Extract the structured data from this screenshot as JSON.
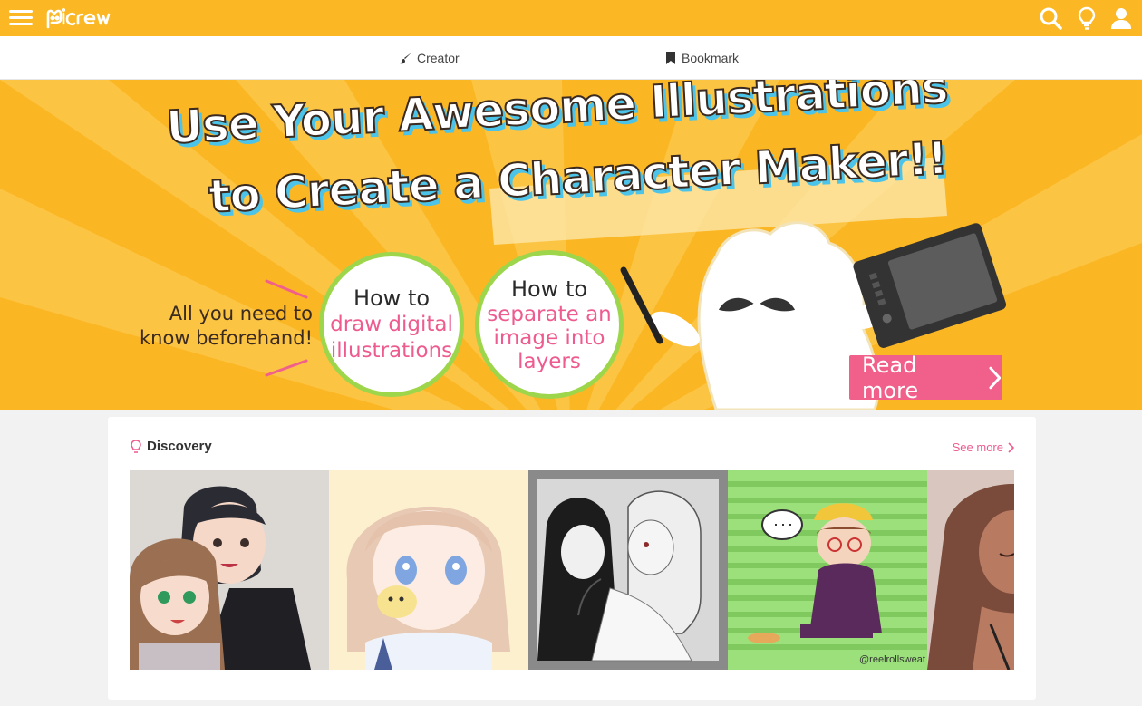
{
  "app": {
    "brand": "picrew",
    "accent": "#fbb824",
    "icons": [
      "menu-icon",
      "search-icon",
      "lightbulb-icon",
      "user-icon"
    ]
  },
  "subnav": {
    "creator_label": "Creator",
    "bookmark_label": "Bookmark"
  },
  "banner": {
    "headline_line1": "Use Your Awesome Illustrations",
    "headline_line2": "to Create a Character Maker!!",
    "side_line1": "All you need to",
    "side_line2": "know beforehand!",
    "circle1_top": "How to",
    "circle1_line2": "draw digital",
    "circle1_line3": "illustrations",
    "circle2_top": "How to",
    "circle2_line2": "separate an",
    "circle2_line3": "image into",
    "circle2_line4": "layers",
    "cta_label": "Read more",
    "colors": {
      "background": "#fbb624",
      "pink": "#ee5b8f",
      "green": "#9dd54b",
      "blue_shadow": "#4cc3e8"
    }
  },
  "discovery": {
    "title": "Discovery",
    "see_more_label": "See more",
    "items": [
      {
        "name": "couple-illustration"
      },
      {
        "name": "blonde-girl-with-chick"
      },
      {
        "name": "monochrome-embrace"
      },
      {
        "name": "boy-in-yellow-beanie",
        "watermark": "@reelrollsweat"
      },
      {
        "name": "long-hair-woman"
      }
    ]
  }
}
